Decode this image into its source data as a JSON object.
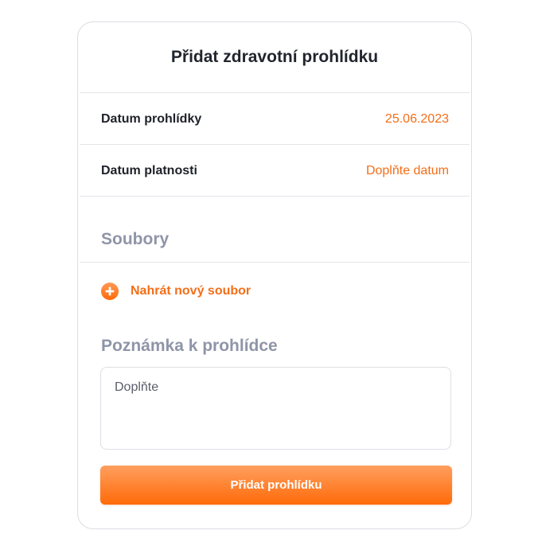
{
  "dialog": {
    "title": "Přidat zdravotní prohlídku"
  },
  "rows": [
    {
      "label": "Datum prohlídky",
      "value": "25.06.2023"
    },
    {
      "label": "Datum platnosti",
      "value": "Doplňte datum"
    }
  ],
  "files": {
    "section_title": "Soubory",
    "upload_label": "Nahrát nový soubor",
    "upload_icon": "plus-circle-icon"
  },
  "note": {
    "section_title": "Poznámka k prohlídce",
    "placeholder": "Doplňte",
    "value": ""
  },
  "submit": {
    "label": "Přidat prohlídku"
  },
  "colors": {
    "accent": "#f46e18",
    "button_gradient_top": "#ff9f5f",
    "button_gradient_bottom": "#ff6a08",
    "section_title": "#8f95a8",
    "text": "#1e2129",
    "border": "#dcdde3"
  }
}
